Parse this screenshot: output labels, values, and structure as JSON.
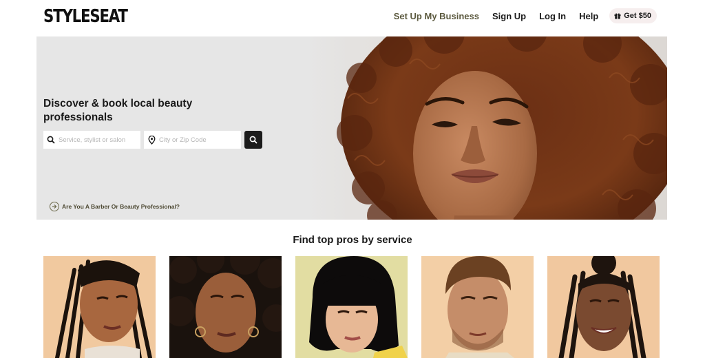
{
  "header": {
    "logo": "STYLESEAT",
    "nav": {
      "business": "Set Up My Business",
      "signup": "Sign Up",
      "login": "Log In",
      "help": "Help",
      "promo": "Get $50"
    }
  },
  "hero": {
    "title": "Discover & book local beauty professionals",
    "service_placeholder": "Service, stylist or salon",
    "city_placeholder": "City or Zip Code",
    "pro_link": "Are You A Barber Or Beauty Professional?"
  },
  "services": {
    "title": "Find top pros by service"
  },
  "colors": {
    "hero_bg": "#e6e6e6",
    "accent_olive": "#5c5a3f",
    "promo_bg": "#f6eeee",
    "card_bg": "#f4c9a0"
  }
}
